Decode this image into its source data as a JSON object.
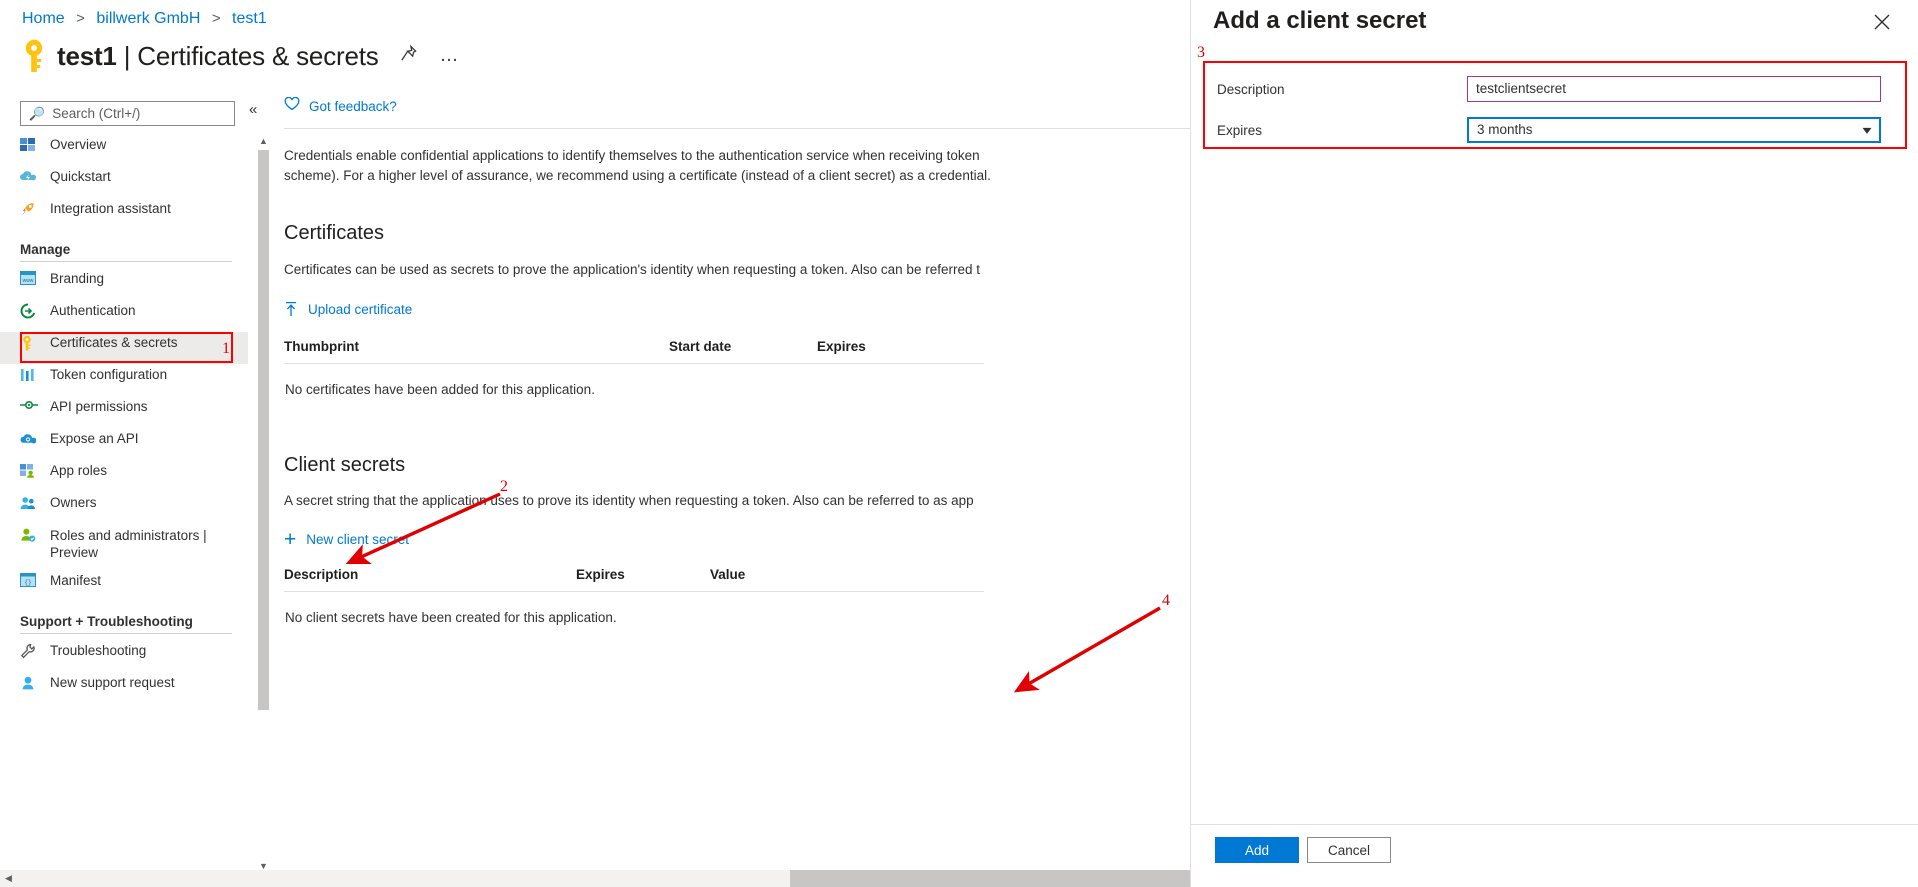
{
  "breadcrumb": {
    "items": [
      "Home",
      "billwerk GmbH",
      "test1"
    ],
    "separator": ">"
  },
  "header": {
    "title_bold": "test1",
    "title_rest": " | Certificates & secrets",
    "pin_icon": "pin-icon",
    "more_icon": "…"
  },
  "search": {
    "placeholder": "Search (Ctrl+/)",
    "value": "",
    "icon": "search-icon"
  },
  "collapse_icon": "«",
  "sidebar": {
    "items": [
      {
        "label": "Overview",
        "icon": "overview-icon",
        "selected": false
      },
      {
        "label": "Quickstart",
        "icon": "quickstart-icon",
        "selected": false
      },
      {
        "label": "Integration assistant",
        "icon": "rocket-icon",
        "selected": false
      }
    ],
    "group_manage": "Manage",
    "manage_items": [
      {
        "label": "Branding",
        "icon": "branding-icon",
        "selected": false
      },
      {
        "label": "Authentication",
        "icon": "authentication-icon",
        "selected": false
      },
      {
        "label": "Certificates & secrets",
        "icon": "key-icon",
        "selected": true
      },
      {
        "label": "Token configuration",
        "icon": "token-icon",
        "selected": false
      },
      {
        "label": "API permissions",
        "icon": "api-permissions-icon",
        "selected": false
      },
      {
        "label": "Expose an API",
        "icon": "expose-api-icon",
        "selected": false
      },
      {
        "label": "App roles",
        "icon": "app-roles-icon",
        "selected": false
      },
      {
        "label": "Owners",
        "icon": "owners-icon",
        "selected": false
      },
      {
        "label": "Roles and administrators | Preview",
        "icon": "roles-admin-icon",
        "selected": false
      },
      {
        "label": "Manifest",
        "icon": "manifest-icon",
        "selected": false
      }
    ],
    "group_support": "Support + Troubleshooting",
    "support_items": [
      {
        "label": "Troubleshooting",
        "icon": "wrench-icon",
        "selected": false
      },
      {
        "label": "New support request",
        "icon": "support-icon",
        "selected": false
      }
    ]
  },
  "content": {
    "feedback_label": "Got feedback?",
    "intro": "Credentials enable confidential applications to identify themselves to the authentication service when receiving token",
    "intro_line2": "scheme). For a higher level of assurance, we recommend using a certificate (instead of a client secret) as a credential.",
    "certificates": {
      "heading": "Certificates",
      "description": "Certificates can be used as secrets to prove the application's identity when requesting a token. Also can be referred t",
      "upload_label": "Upload certificate",
      "upload_icon": "upload-icon",
      "columns": [
        "Thumbprint",
        "Start date",
        "Expires"
      ],
      "empty_text": "No certificates have been added for this application."
    },
    "client_secrets": {
      "heading": "Client secrets",
      "description": "A secret string that the application uses to prove its identity when requesting a token. Also can be referred to as app",
      "new_label": "New client secret",
      "new_icon": "plus-icon",
      "columns": [
        "Description",
        "Expires",
        "Value"
      ],
      "empty_text": "No client secrets have been created for this application."
    }
  },
  "panel": {
    "title": "Add a client secret",
    "close_icon": "close-icon",
    "description_label": "Description",
    "description_value": "testclientsecret",
    "expires_label": "Expires",
    "expires_value": "3 months",
    "expires_chevron": "chevron-down-icon",
    "add_label": "Add",
    "cancel_label": "Cancel"
  },
  "annotations": {
    "numbers": [
      "1",
      "2",
      "3",
      "4"
    ],
    "color": "#e00000",
    "highlight_color": "#ff0000"
  },
  "colors": {
    "accent": "#0078d4",
    "link": "#0078d4",
    "text": "#323130",
    "selected_bg": "#edebe9",
    "description_border": "#a4368c",
    "expires_border": "#0078d4"
  }
}
